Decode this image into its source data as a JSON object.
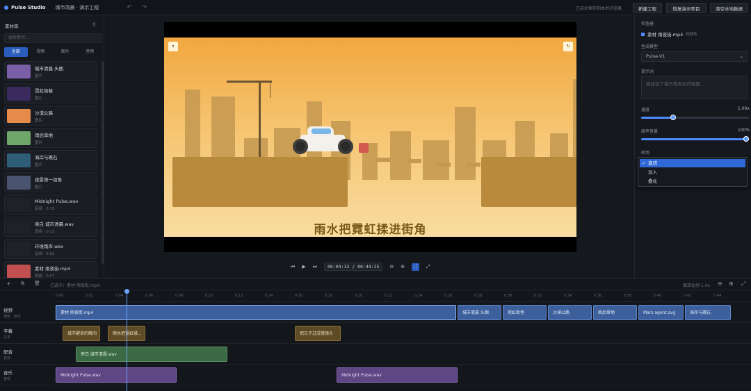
{
  "app": {
    "name": "Pulse Studio",
    "project_title": "城市清晨 · 演示工程",
    "undo": "↶",
    "redo": "↷"
  },
  "topbar": {
    "status": "已自动保存到本地浏览器",
    "buttons": [
      "新建工程",
      "恢复演示项目",
      "清空本地数据"
    ]
  },
  "library": {
    "title": "素材库",
    "search_placeholder": "搜索素材...",
    "tabs": [
      "全部",
      "视频",
      "图片",
      "音频"
    ],
    "active_tab": "全部",
    "items": [
      {
        "name": "城市清晨 头图",
        "sub": "图片",
        "thumb": "#7a5fa8"
      },
      {
        "name": "霓虹街巷",
        "sub": "图片",
        "thumb": "#3b2a5e"
      },
      {
        "name": "沙漠公路",
        "sub": "图片",
        "thumb": "#e58c4a"
      },
      {
        "name": "雨后草地",
        "sub": "图片",
        "thumb": "#6fa66a"
      },
      {
        "name": "海岸与礁石",
        "sub": "图片",
        "thumb": "#2f5f78"
      },
      {
        "name": "夜景第一视角",
        "sub": "图片",
        "thumb": "#4a5470"
      },
      {
        "name": "Midnight Pulse.wav",
        "sub": "音频 · 0:15",
        "thumb": "#1e2127"
      },
      {
        "name": "旁白 城市清晨.wav",
        "sub": "音频 · 0:13",
        "thumb": "#1e2127"
      },
      {
        "name": "环境雨声.wav",
        "sub": "音频 · 0:02",
        "thumb": "#1e2127"
      },
      {
        "name": "素材 雨夜街.mp4",
        "sub": "视频 · 0:07",
        "thumb": "#c24f4f"
      }
    ]
  },
  "player": {
    "corner_left": "⏸",
    "corner_right": "↻",
    "subtitle": "雨水把霓虹揉进街角",
    "timecode": "00:04:13",
    "duration": "00:44:15",
    "controls": [
      "⏮",
      "▶",
      "⏭"
    ],
    "zoom_out": "⊖",
    "zoom_in": "⊕",
    "fit": "⛶",
    "fullscreen": "⤢"
  },
  "inspector": {
    "title": "检查器",
    "clip_name": "素材 雨夜街.mp4",
    "clip_tag": "视频轨",
    "model_label": "生成模型",
    "model_value": "Pulse-V1",
    "prompt_label": "提示词",
    "prompt_placeholder": "描述这个镜头想表达的画面...",
    "speed_label": "速度",
    "speed_value": "1.00x",
    "speed_level": 0.27,
    "volume_label": "原声音量",
    "volume_value": "100%",
    "volume_level": 1.0,
    "transition_label": "转场",
    "transition_options": [
      "直切",
      "淡入",
      "叠化"
    ],
    "transition_selected": "直切"
  },
  "timeline": {
    "clip_selected": "已选中：素材 雨夜街.mp4",
    "zoom_label": "缩放比例 1.4x",
    "ticks": [
      "0:00",
      "0:02",
      "0:04",
      "0:06",
      "0:08",
      "0:10",
      "0:12",
      "0:14",
      "0:16",
      "0:18",
      "0:20",
      "0:22",
      "0:24",
      "0:26",
      "0:28",
      "0:30",
      "0:32",
      "0:34",
      "0:36",
      "0:38",
      "0:40",
      "0:42",
      "0:44"
    ],
    "tracks": [
      {
        "name": "视频",
        "sub": "视频 · 锁定"
      },
      {
        "name": "字幕",
        "sub": "文本"
      },
      {
        "name": "配音",
        "sub": "音频"
      },
      {
        "name": "音乐",
        "sub": "音频"
      }
    ],
    "video_clips": [
      "素材 雨夜街.mp4",
      "城市清晨 头图",
      "霓虹街巷",
      "沙漠公路",
      "雨后草地",
      "Mars agent.svg",
      "海岸与礁石"
    ],
    "subtitle_clips": [
      "城市醒来的瞬间",
      "雨水把霓虹揉...",
      "把日子过成慢镜头"
    ],
    "voice_clips": [
      "旁白 城市清晨.wav"
    ],
    "music_clips": [
      "Midnight Pulse.wav",
      "Midnight Pulse.wav"
    ]
  }
}
